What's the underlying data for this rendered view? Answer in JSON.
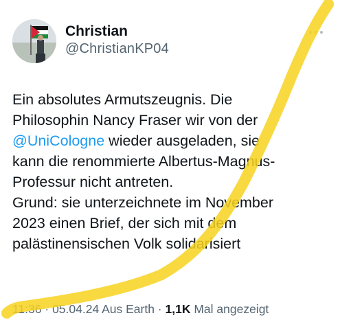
{
  "author": {
    "display_name": "Christian",
    "handle": "@ChristianKP04"
  },
  "tweet": {
    "lines": [
      [
        {
          "text": "Ein absolutes Armutszeugnis. Die"
        }
      ],
      [
        {
          "text": "Philosophin Nancy Fraser wir von der"
        }
      ],
      [
        {
          "text": "@UniCologne",
          "mention": true
        },
        {
          "text": " wieder ausgeladen, sie"
        }
      ],
      [
        {
          "text": "kann die renommierte Albertus-Magnus-"
        }
      ],
      [
        {
          "text": "Professur nicht antreten."
        }
      ],
      [
        {
          "text": "Grund: sie unterzeichnete im November"
        }
      ],
      [
        {
          "text": "2023 einen Brief, der sich mit dem"
        }
      ],
      [
        {
          "text": "palästinensischen Volk solidarisiert"
        }
      ]
    ]
  },
  "meta": {
    "time": "11:36",
    "sep1": " · ",
    "date": "05.04.24",
    "location": " Aus Earth",
    "sep2": " · ",
    "views_count": "1,1K",
    "views_label": " Mal angezeigt"
  },
  "icons": {
    "more": "more-dots-icon"
  },
  "colors": {
    "text": "#0f1419",
    "secondary": "#536471",
    "mention": "#1d9bf0",
    "highlight": "#f7d21e"
  }
}
